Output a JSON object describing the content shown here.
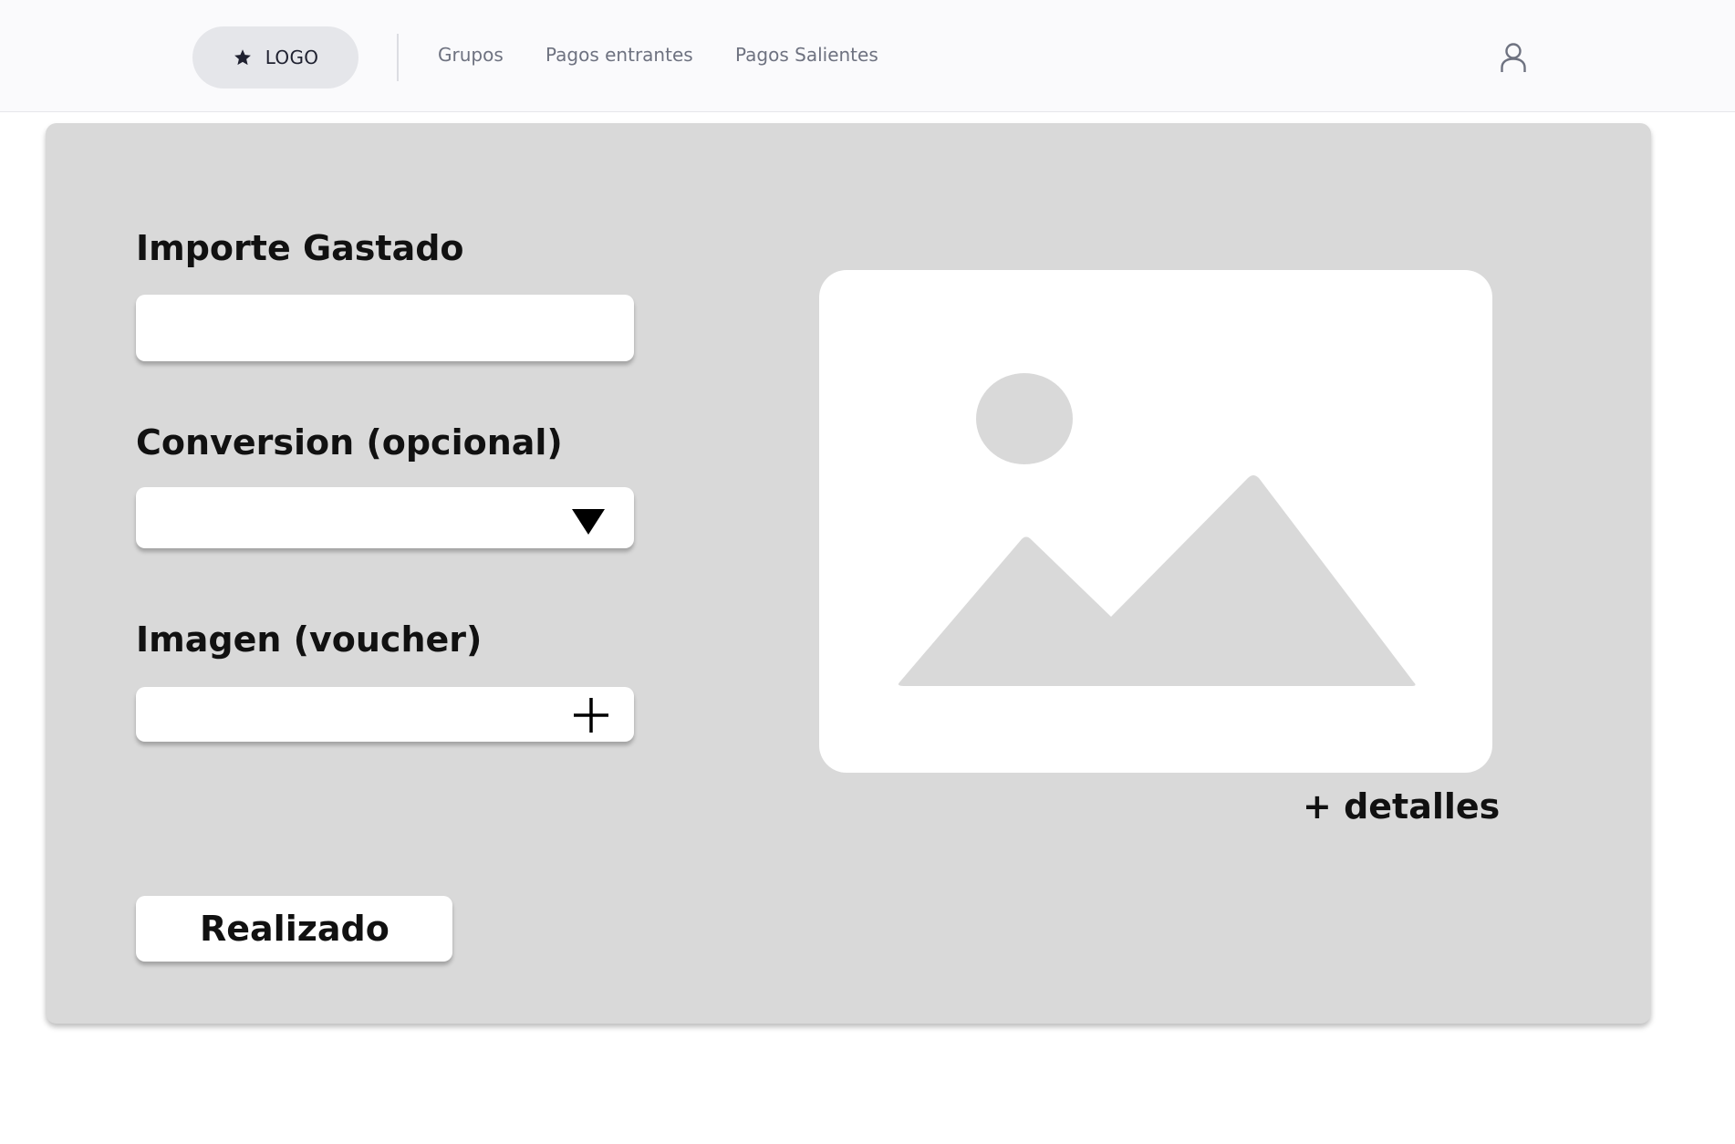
{
  "navbar": {
    "logo_icon": "star-icon",
    "logo_label": "LOGO",
    "links": [
      {
        "label": "Grupos"
      },
      {
        "label": "Pagos entrantes"
      },
      {
        "label": "Pagos Salientes"
      }
    ],
    "user_icon": "user-icon"
  },
  "form": {
    "amount_label": "Importe Gastado",
    "amount_value": "",
    "conversion_label": "Conversion (opcional)",
    "conversion_value": "",
    "image_label": "Imagen (voucher)",
    "image_value": "",
    "submit_label": "Realizado"
  },
  "preview": {
    "icon": "image-placeholder-icon",
    "details_link": "+ detalles"
  },
  "colors": {
    "page_background": "#ffffff",
    "navbar_background": "#fafafc",
    "card_background": "#d9d9d9",
    "logo_pill": "#e5e6ea",
    "nav_text": "#6e7280",
    "placeholder_shapes": "#d9d9d9"
  }
}
